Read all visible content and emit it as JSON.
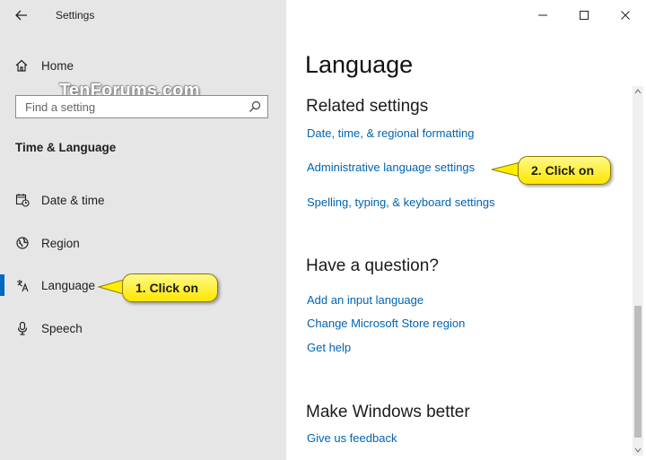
{
  "window": {
    "title": "Settings",
    "controls": [
      "minimize",
      "maximize",
      "close"
    ]
  },
  "watermark": "TenForums.com",
  "sidebar": {
    "home_label": "Home",
    "search": {
      "placeholder": "Find a setting",
      "value": ""
    },
    "section_heading": "Time & Language",
    "items": [
      {
        "label": "Date & time",
        "icon": "calendar-clock-icon"
      },
      {
        "label": "Region",
        "icon": "globe-icon"
      },
      {
        "label": "Language",
        "icon": "language-icon",
        "active": true
      },
      {
        "label": "Speech",
        "icon": "microphone-icon"
      }
    ]
  },
  "main": {
    "title": "Language",
    "related": {
      "heading": "Related settings",
      "links": [
        "Date, time, & regional formatting",
        "Administrative language settings",
        "Spelling, typing, & keyboard settings"
      ]
    },
    "question": {
      "heading": "Have a question?",
      "links": [
        "Add an input language",
        "Change Microsoft Store region",
        "Get help"
      ]
    },
    "better": {
      "heading": "Make Windows better",
      "links": [
        "Give us feedback"
      ]
    }
  },
  "callouts": {
    "first": "1. Click on",
    "second": "2. Click on"
  },
  "scrollbar": {
    "thumb_start": 0.6,
    "thumb_size": 0.38
  },
  "colors": {
    "sidebar_bg": "#e6e6e6",
    "link": "#0063b1",
    "accent": "#0067c0",
    "callout_fill": "#fff200"
  }
}
